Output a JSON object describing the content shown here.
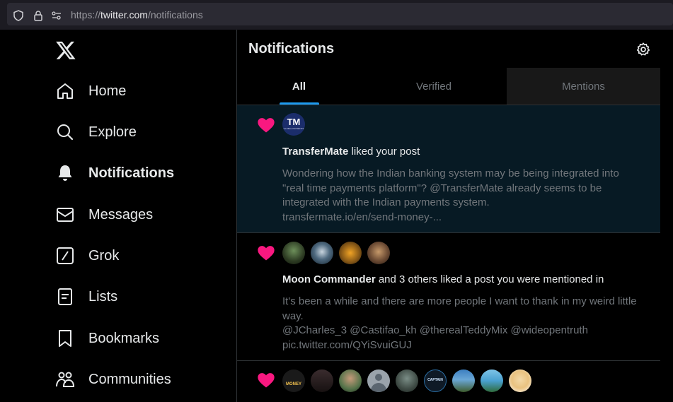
{
  "browser": {
    "url_prefix": "https://",
    "url_host": "twitter.com",
    "url_path": "/notifications"
  },
  "sidebar": {
    "items": [
      {
        "label": "Home",
        "icon": "home-icon"
      },
      {
        "label": "Explore",
        "icon": "search-icon"
      },
      {
        "label": "Notifications",
        "icon": "bell-icon",
        "active": true
      },
      {
        "label": "Messages",
        "icon": "envelope-icon"
      },
      {
        "label": "Grok",
        "icon": "grok-icon"
      },
      {
        "label": "Lists",
        "icon": "list-icon"
      },
      {
        "label": "Bookmarks",
        "icon": "bookmark-icon"
      },
      {
        "label": "Communities",
        "icon": "people-icon"
      }
    ]
  },
  "header": {
    "title": "Notifications"
  },
  "tabs": [
    {
      "label": "All",
      "active": true
    },
    {
      "label": "Verified"
    },
    {
      "label": "Mentions"
    }
  ],
  "notifications": [
    {
      "actor": "TransferMate",
      "action": " liked your post",
      "body_lines": [
        "Wondering how the Indian banking system may be being integrated into",
        "\"real time payments platform\"? @TransferMate already seems to be",
        "integrated with the Indian payments system.",
        "transfermate.io/en/send-money-..."
      ],
      "avatar_label": "TM",
      "avatar_sub": "GLOBAL PAYMENTS"
    },
    {
      "actor": "Moon Commander",
      "action": " and 3 others liked a post you were mentioned in",
      "body_lines": [
        "It's been a while and there are more people I want to thank in my weird little",
        "way.",
        "@JCharles_3 @Castifao_kh @therealTeddyMix @wideopentruth",
        "pic.twitter.com/QYiSvuiGUJ"
      ]
    },
    {
      "avatar_labels": [
        "MONEY",
        "CAPTAIN"
      ]
    }
  ],
  "colors": {
    "accent": "#1d9bf0",
    "heart": "#f91880",
    "highlight_bg": "#071a24"
  }
}
